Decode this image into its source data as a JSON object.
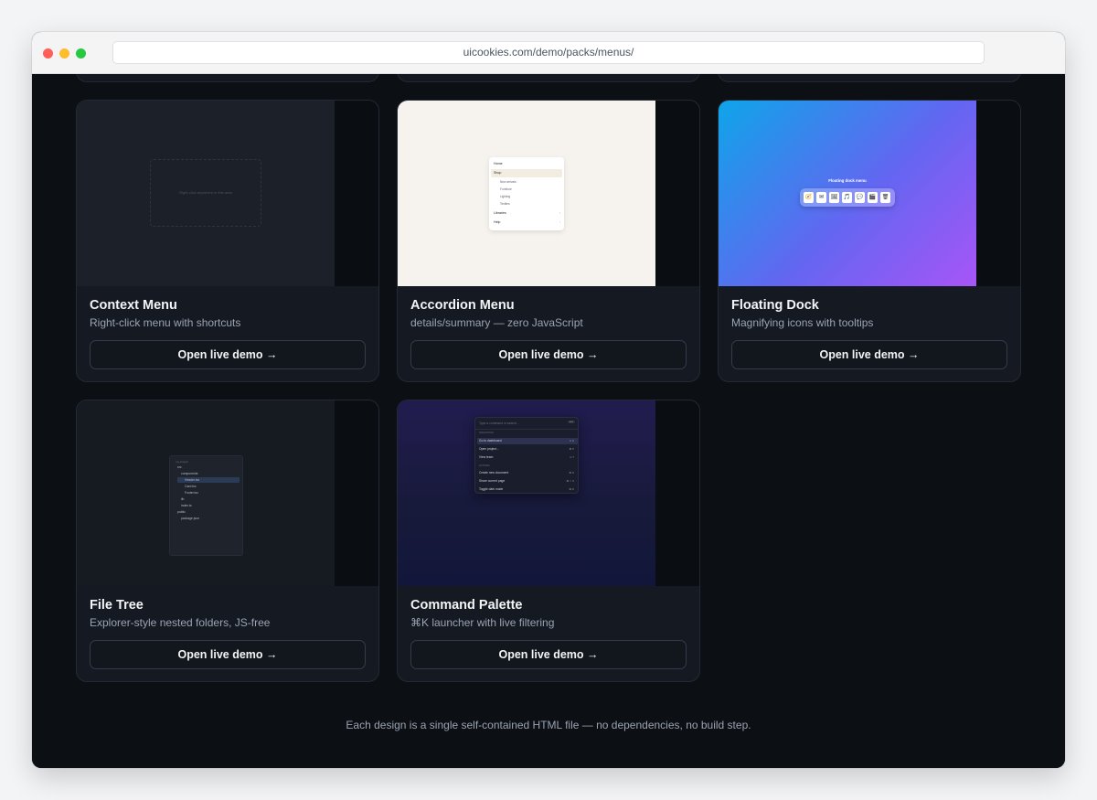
{
  "browser": {
    "url": "uicookies.com/demo/packs/menus/"
  },
  "cards": [
    {
      "title": "Context Menu",
      "subtitle": "Right-click menu with shortcuts",
      "button": "Open live demo →",
      "preview": {
        "hint": "Right-click anywhere in this area"
      }
    },
    {
      "title": "Accordion Menu",
      "subtitle": "details/summary — zero JavaScript",
      "button": "Open live demo →",
      "preview": {
        "items": [
          "Home",
          "Shop",
          "Libraries",
          "Help"
        ],
        "subitems": [
          "New arrivals",
          "Furniture",
          "Lighting",
          "Textiles"
        ]
      }
    },
    {
      "title": "Floating Dock",
      "subtitle": "Magnifying icons with tooltips",
      "button": "Open live demo →",
      "preview": {
        "label": "Floating dock menu",
        "icons": [
          "🧭",
          "✉",
          "🖼",
          "🎵",
          "💬",
          "🎬",
          "🗑"
        ]
      }
    },
    {
      "title": "File Tree",
      "subtitle": "Explorer-style nested folders, JS-free",
      "button": "Open live demo →",
      "preview": {
        "header": "my-project",
        "rows": [
          "src",
          "components",
          "Header.tsx",
          "Card.tsx",
          "Footer.tsx",
          "lib",
          "index.ts",
          "public",
          "package.json"
        ]
      }
    },
    {
      "title": "Command Palette",
      "subtitle": "⌘K launcher with live filtering",
      "button": "Open live demo →",
      "preview": {
        "placeholder": "Type a command or search…",
        "esc": "esc",
        "group1": "NAVIGATION",
        "group2": "ACTIONS",
        "nav": [
          "Go to dashboard",
          "Open project…",
          "View team"
        ],
        "actions": [
          "Create new document",
          "Share current page",
          "Toggle dark mode"
        ],
        "shortcuts": [
          "G D",
          "⌘ P",
          "G T",
          "⌘ N",
          "⌘ ⇧ S",
          "⌘ D"
        ]
      }
    }
  ],
  "footer": {
    "text": "Each design is a single self-contained HTML file — no dependencies, no build step."
  }
}
